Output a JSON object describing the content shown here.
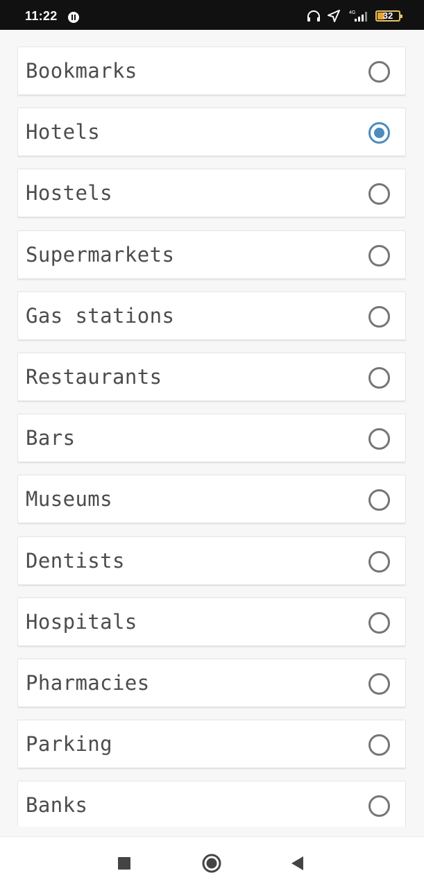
{
  "status_bar": {
    "time": "11:22",
    "network": "4G",
    "battery": "32",
    "icons": [
      "pause-icon",
      "headphones-icon",
      "location-arrow-icon",
      "signal-icon",
      "battery-icon"
    ]
  },
  "categories": {
    "selected": "Hotels",
    "items": [
      {
        "label": "Bookmarks",
        "checked": false
      },
      {
        "label": "Hotels",
        "checked": true
      },
      {
        "label": "Hostels",
        "checked": false
      },
      {
        "label": "Supermarkets",
        "checked": false
      },
      {
        "label": "Gas stations",
        "checked": false
      },
      {
        "label": "Restaurants",
        "checked": false
      },
      {
        "label": "Bars",
        "checked": false
      },
      {
        "label": "Museums",
        "checked": false
      },
      {
        "label": "Dentists",
        "checked": false
      },
      {
        "label": "Hospitals",
        "checked": false
      },
      {
        "label": "Pharmacies",
        "checked": false
      },
      {
        "label": "Parking",
        "checked": false
      },
      {
        "label": "Banks",
        "checked": false
      }
    ]
  },
  "nav_bar": {
    "buttons": [
      "recent-apps-icon",
      "home-icon",
      "back-icon"
    ]
  },
  "colors": {
    "accent": "#4d8bbd",
    "radio_unchecked": "#757575",
    "text": "#4c4c4c",
    "background": "#f7f7f7",
    "status_bar": "#111111"
  }
}
